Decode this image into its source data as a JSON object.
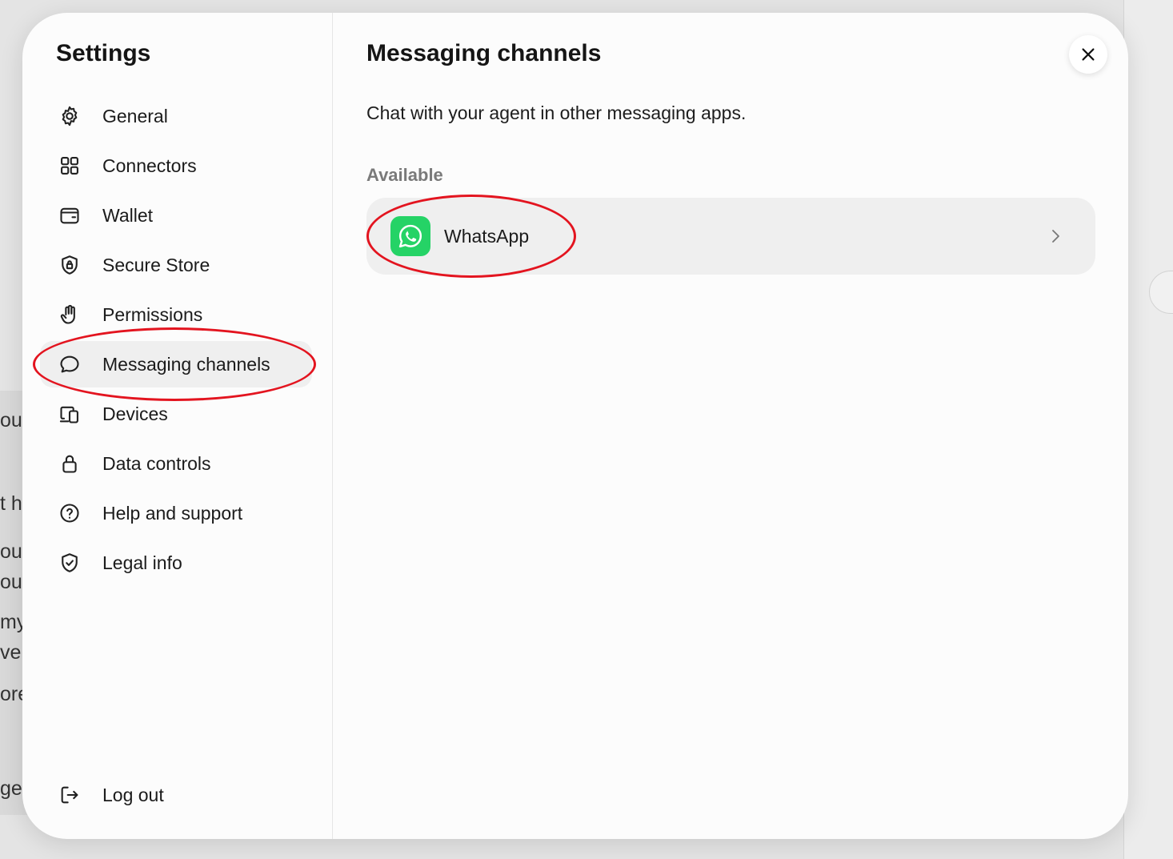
{
  "background": {
    "peek_lines": [
      "ou",
      "t h",
      "ou",
      "ou",
      "my",
      "ve",
      "ore",
      "ge"
    ]
  },
  "sidebar": {
    "title": "Settings",
    "items": [
      {
        "label": "General",
        "icon": "gear-icon"
      },
      {
        "label": "Connectors",
        "icon": "grid-icon"
      },
      {
        "label": "Wallet",
        "icon": "wallet-icon"
      },
      {
        "label": "Secure Store",
        "icon": "shield-lock-icon"
      },
      {
        "label": "Permissions",
        "icon": "hand-icon"
      },
      {
        "label": "Messaging channels",
        "icon": "chat-bubble-icon",
        "active": true
      },
      {
        "label": "Devices",
        "icon": "devices-icon"
      },
      {
        "label": "Data controls",
        "icon": "lock-icon"
      },
      {
        "label": "Help and support",
        "icon": "question-circle-icon"
      },
      {
        "label": "Legal info",
        "icon": "shield-check-icon"
      }
    ],
    "logout": {
      "label": "Log out",
      "icon": "logout-icon"
    }
  },
  "main": {
    "title": "Messaging channels",
    "description": "Chat with your agent in other messaging apps.",
    "section_label": "Available",
    "channels": [
      {
        "name": "WhatsApp",
        "icon": "whatsapp-icon",
        "brand_color": "#25d366"
      }
    ],
    "close_icon": "close-icon"
  },
  "annotation_color": "#e3141f"
}
